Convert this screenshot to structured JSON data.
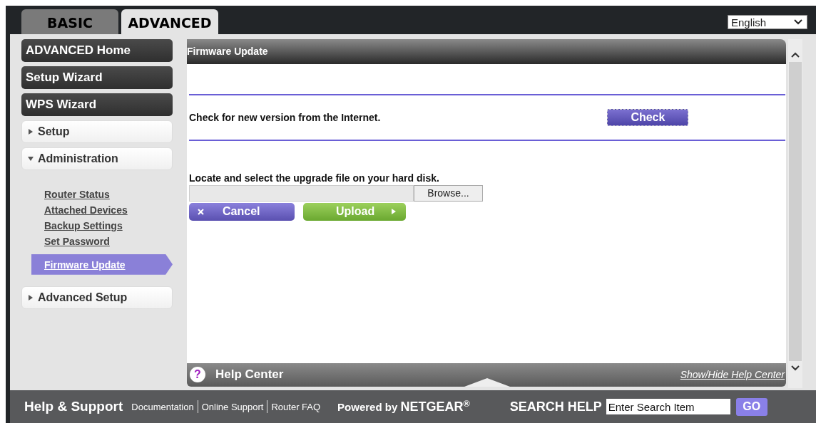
{
  "tabs": [
    {
      "label": "BASIC",
      "selected": false
    },
    {
      "label": "ADVANCED",
      "selected": true
    }
  ],
  "language": {
    "value": "English"
  },
  "sidebar": {
    "items": [
      {
        "kind": "main",
        "label": "ADVANCED Home"
      },
      {
        "kind": "main",
        "label": "Setup Wizard"
      },
      {
        "kind": "main",
        "label": "WPS Wizard"
      },
      {
        "kind": "section",
        "label": "Setup",
        "expanded": false
      },
      {
        "kind": "section",
        "label": "Administration",
        "expanded": true,
        "children": [
          {
            "label": "Router Status",
            "selected": false
          },
          {
            "label": "Attached Devices",
            "selected": false
          },
          {
            "label": "Backup Settings",
            "selected": false
          },
          {
            "label": "Set Password",
            "selected": false
          },
          {
            "label": "Firmware Update",
            "selected": true
          }
        ]
      },
      {
        "kind": "section",
        "label": "Advanced Setup",
        "expanded": false
      }
    ]
  },
  "panel": {
    "title": "Firmware Update",
    "check_text": "Check for new version from the Internet.",
    "check_button": "Check",
    "upload_text": "Locate and select the upgrade file on your hard disk.",
    "browse_button": "Browse...",
    "cancel_button": "Cancel",
    "upload_button": "Upload"
  },
  "help_center": {
    "icon": "?",
    "title": "Help Center",
    "toggle": "Show/Hide Help Center"
  },
  "footer": {
    "title": "Help & Support",
    "links": [
      "Documentation",
      "Online Support",
      "Router FAQ"
    ],
    "powered_by": "Powered by **NETGEAR**$^{®}$",
    "search_label": "SEARCH HELP",
    "search_placeholder": "Enter Search Item",
    "go_button": "GO"
  }
}
